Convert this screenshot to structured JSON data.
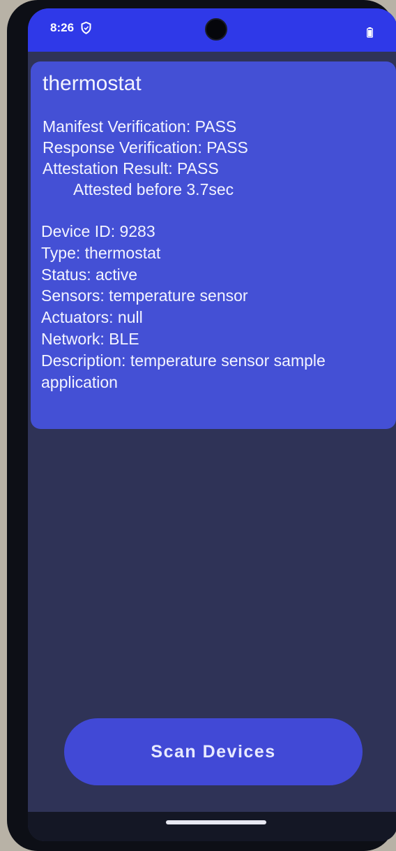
{
  "status_bar": {
    "time": "8:26",
    "icons": [
      "shield-icon",
      "camera-icon",
      "battery-icon"
    ]
  },
  "device_card": {
    "title": "thermostat",
    "verification": {
      "manifest": "Manifest Verification: PASS",
      "response": "Response Verification: PASS",
      "attestation": "Attestation Result: PASS",
      "attested_time": "Attested before 3.7sec"
    },
    "details": {
      "device_id": "Device ID: 9283",
      "type": "Type: thermostat",
      "status": "Status: active",
      "sensors": "Sensors: temperature sensor",
      "actuators": "Actuators: null",
      "network": "Network: BLE",
      "description": "Description: temperature sensor sample application"
    }
  },
  "scan_button": {
    "label": "Scan Devices"
  },
  "colors": {
    "status_bar": "#2f39e8",
    "card": "#4450d5",
    "background": "#2f3357",
    "button": "#4149d6"
  }
}
